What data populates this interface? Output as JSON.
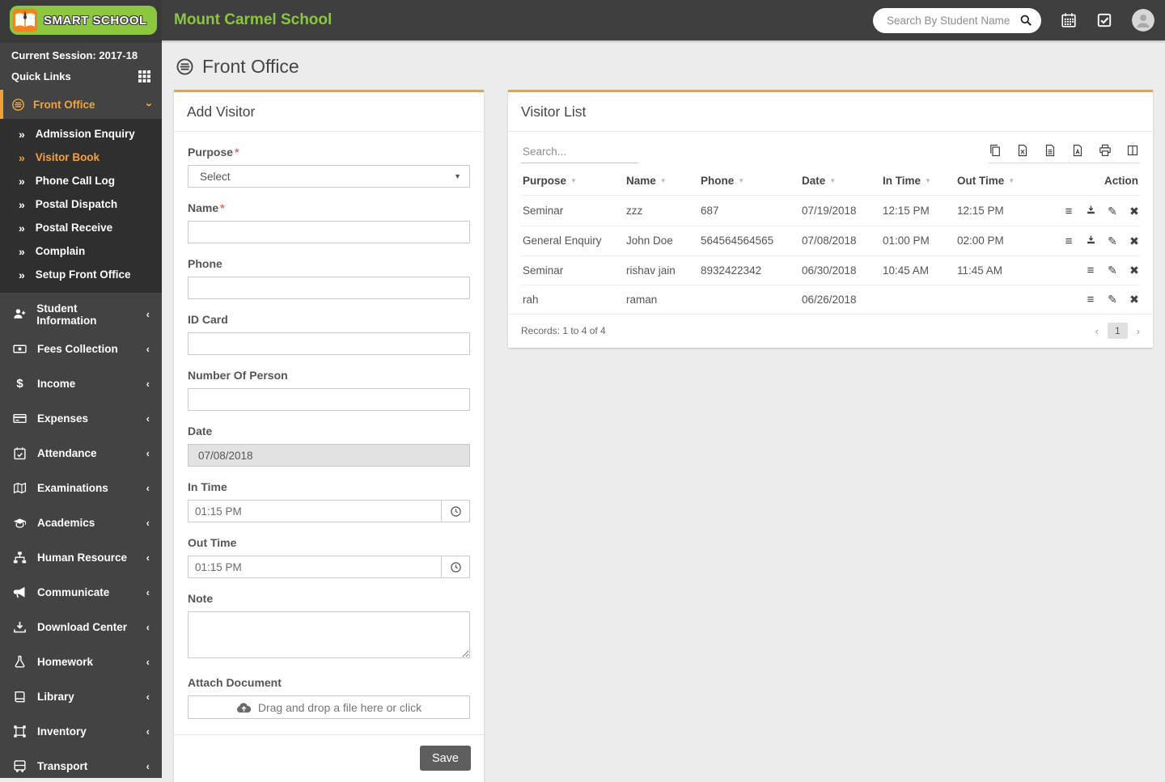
{
  "colors": {
    "accent_orange": "#f0a131",
    "brand_green": "#8dc63f",
    "header_bg": "#3f3f3f",
    "sidebar_bg": "#434343",
    "submenu_bg": "#2f2f2f",
    "page_bg": "#ececec",
    "save_button_bg": "#5e5e5e"
  },
  "header": {
    "logo_text": "SMART SCHOOL",
    "school_name": "Mount Carmel School",
    "search_placeholder": "Search By Student Name"
  },
  "sidebar": {
    "session_label": "Current Session: 2017-18",
    "quick_links_label": "Quick Links",
    "front_office": {
      "label": "Front Office",
      "items": [
        {
          "label": "Admission Enquiry",
          "active": false
        },
        {
          "label": "Visitor Book",
          "active": true
        },
        {
          "label": "Phone Call Log",
          "active": false
        },
        {
          "label": "Postal Dispatch",
          "active": false
        },
        {
          "label": "Postal Receive",
          "active": false
        },
        {
          "label": "Complain",
          "active": false
        },
        {
          "label": "Setup Front Office",
          "active": false
        }
      ]
    },
    "items": [
      {
        "label": "Student Information",
        "icon": "user-plus"
      },
      {
        "label": "Fees Collection",
        "icon": "cash"
      },
      {
        "label": "Income",
        "icon": "dollar"
      },
      {
        "label": "Expenses",
        "icon": "credit-card"
      },
      {
        "label": "Attendance",
        "icon": "calendar-check"
      },
      {
        "label": "Examinations",
        "icon": "map-book"
      },
      {
        "label": "Academics",
        "icon": "graduation-cap"
      },
      {
        "label": "Human Resource",
        "icon": "sitemap"
      },
      {
        "label": "Communicate",
        "icon": "megaphone"
      },
      {
        "label": "Download Center",
        "icon": "download"
      },
      {
        "label": "Homework",
        "icon": "flask"
      },
      {
        "label": "Library",
        "icon": "book"
      },
      {
        "label": "Inventory",
        "icon": "box"
      },
      {
        "label": "Transport",
        "icon": "bus"
      }
    ]
  },
  "page": {
    "title": "Front Office"
  },
  "add_visitor": {
    "title": "Add Visitor",
    "required_mark": "*",
    "purpose_label": "Purpose",
    "purpose_value": "Select",
    "name_label": "Name",
    "phone_label": "Phone",
    "id_card_label": "ID Card",
    "number_of_person_label": "Number Of Person",
    "date_label": "Date",
    "date_value": "07/08/2018",
    "in_time_label": "In Time",
    "in_time_value": "01:15 PM",
    "out_time_label": "Out Time",
    "out_time_value": "01:15 PM",
    "note_label": "Note",
    "attach_label": "Attach Document",
    "attach_placeholder": "Drag and drop a file here or click",
    "save_label": "Save"
  },
  "visitor_list": {
    "title": "Visitor List",
    "search_placeholder": "Search...",
    "toolbar": [
      "copy",
      "excel",
      "csv",
      "pdf",
      "print",
      "columns"
    ],
    "columns": [
      {
        "label": "Purpose",
        "sortable": true
      },
      {
        "label": "Name",
        "sortable": true
      },
      {
        "label": "Phone",
        "sortable": true
      },
      {
        "label": "Date",
        "sortable": true
      },
      {
        "label": "In Time",
        "sortable": true
      },
      {
        "label": "Out Time",
        "sortable": true
      },
      {
        "label": "Action",
        "sortable": false
      }
    ],
    "rows": [
      {
        "purpose": "Seminar",
        "name": "zzz",
        "phone": "687",
        "date": "07/19/2018",
        "in_time": "12:15 PM",
        "out_time": "12:15 PM",
        "actions": [
          "details",
          "download",
          "edit",
          "delete"
        ]
      },
      {
        "purpose": "General Enquiry",
        "name": "John Doe",
        "phone": "564564564565",
        "date": "07/08/2018",
        "in_time": "01:00 PM",
        "out_time": "02:00 PM",
        "actions": [
          "details",
          "download",
          "edit",
          "delete"
        ]
      },
      {
        "purpose": "Seminar",
        "name": "rishav jain",
        "phone": "8932422342",
        "date": "06/30/2018",
        "in_time": "10:45 AM",
        "out_time": "11:45 AM",
        "actions": [
          "details",
          "edit",
          "delete"
        ]
      },
      {
        "purpose": "rah",
        "name": "raman",
        "phone": "",
        "date": "06/26/2018",
        "in_time": "",
        "out_time": "",
        "actions": [
          "details",
          "edit",
          "delete"
        ]
      }
    ],
    "records_text": "Records: 1 to 4 of 4",
    "pagination": {
      "prev": "‹",
      "current": "1",
      "next": "›"
    }
  }
}
